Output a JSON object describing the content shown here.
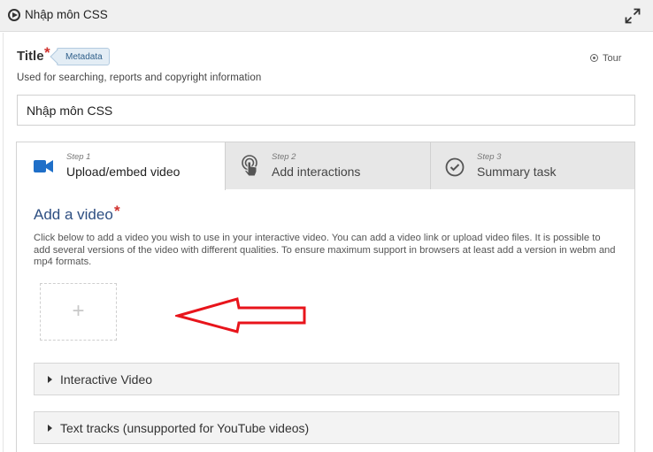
{
  "header": {
    "app_title": "Nhập môn CSS",
    "icons": {
      "play": "play-circle-icon",
      "fullscreen": "fullscreen-expand-icon"
    }
  },
  "title_field": {
    "label": "Title",
    "required_mark": "*",
    "metadata_tag": "Metadata",
    "tour_label": "Tour",
    "description": "Used for searching, reports and copyright information",
    "value": "Nhập môn CSS"
  },
  "tabs": [
    {
      "step": "Step 1",
      "label": "Upload/embed video",
      "icon": "video-camera-icon",
      "active": true
    },
    {
      "step": "Step 2",
      "label": "Add interactions",
      "icon": "touch-hand-icon",
      "active": false
    },
    {
      "step": "Step 3",
      "label": "Summary task",
      "icon": "check-circle-icon",
      "active": false
    }
  ],
  "add_video": {
    "heading": "Add a video",
    "required_mark": "*",
    "description": "Click below to add a video you wish to use in your interactive video. You can add a video link or upload video files. It is possible to add several versions of the video with different qualities. To ensure maximum support in browsers at least add a version in webm and mp4 formats.",
    "add_button_glyph": "+"
  },
  "groups": [
    {
      "label": "Interactive Video"
    },
    {
      "label": "Text tracks (unsupported for YouTube videos)"
    }
  ],
  "colors": {
    "accent_blue": "#2e4f82",
    "required_red": "#d0312d",
    "annotation_arrow": "#e8141b",
    "video_icon_blue": "#1f6fc8"
  }
}
